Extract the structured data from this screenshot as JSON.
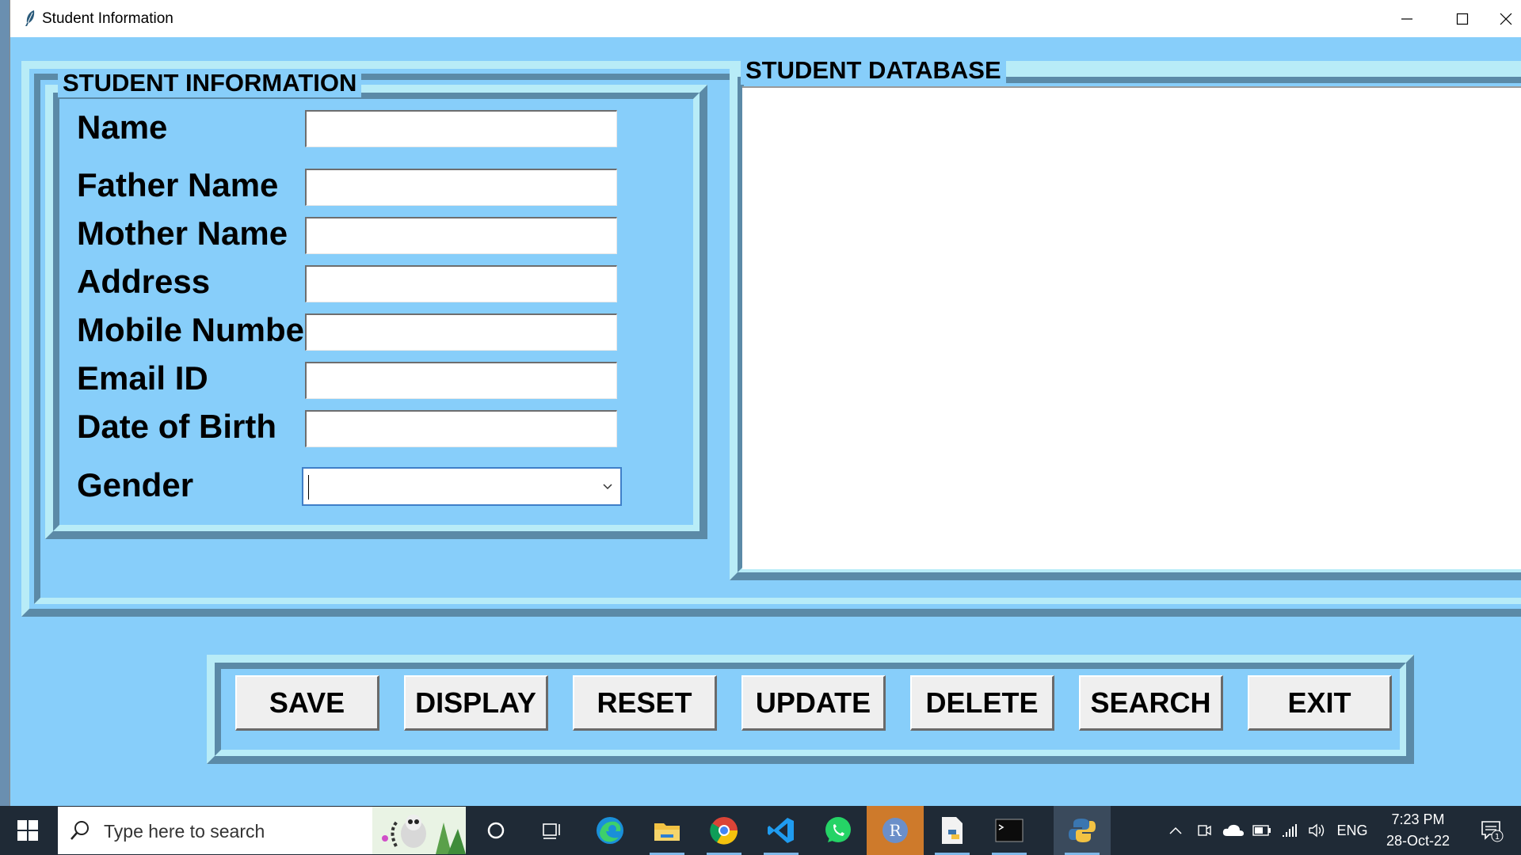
{
  "window": {
    "title": "Student Information"
  },
  "info_frame": {
    "title": "STUDENT INFORMATION",
    "fields": [
      {
        "label": "Name",
        "value": ""
      },
      {
        "label": "Father Name",
        "value": ""
      },
      {
        "label": "Mother Name",
        "value": ""
      },
      {
        "label": "Address",
        "value": ""
      },
      {
        "label": "Mobile Number",
        "value": ""
      },
      {
        "label": "Email ID",
        "value": ""
      },
      {
        "label": "Date of Birth",
        "value": ""
      }
    ],
    "gender": {
      "label": "Gender",
      "value": ""
    }
  },
  "db_frame": {
    "title": "STUDENT DATABASE",
    "rows": []
  },
  "buttons": {
    "save": "SAVE",
    "display": "DISPLAY",
    "reset": "RESET",
    "update": "UPDATE",
    "delete": "DELETE",
    "search": "SEARCH",
    "exit": "EXIT"
  },
  "taskbar": {
    "search_placeholder": "Type here to search",
    "language": "ENG",
    "time": "7:23 PM",
    "date": "28-Oct-22",
    "notification_count": "1",
    "pinned_apps": [
      "cortana-icon",
      "task-view-icon",
      "edge-icon",
      "file-explorer-icon",
      "chrome-icon",
      "vscode-icon",
      "whatsapp-icon",
      "r-icon",
      "python-file-icon",
      "terminal-icon",
      "python-icon"
    ]
  },
  "colors": {
    "background": "#87cefa",
    "frame_light": "#b8ecf7",
    "frame_dark": "#5b8aa7",
    "taskbar": "#1f2a36"
  }
}
